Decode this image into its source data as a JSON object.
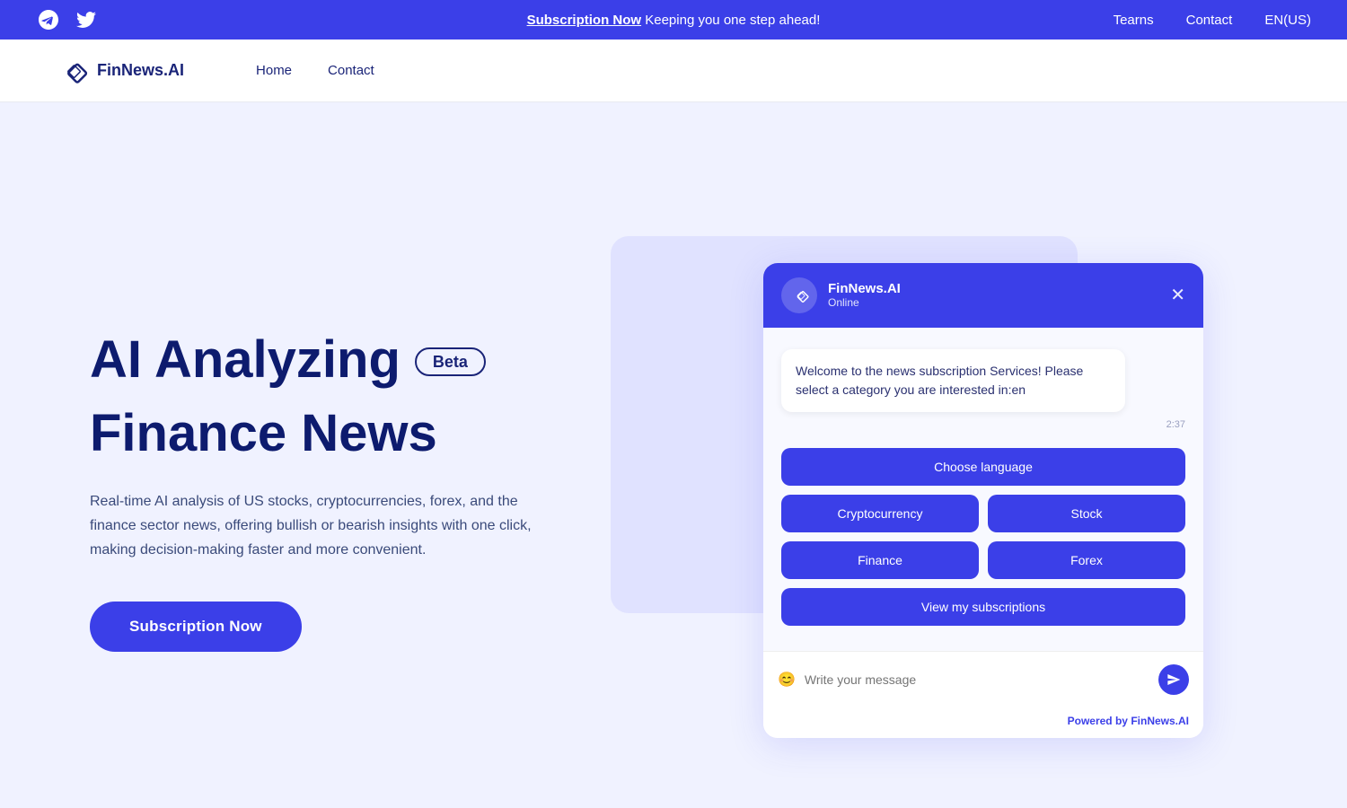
{
  "topBanner": {
    "subscriptionLink": "Subscription Now",
    "tagline": " Keeping you one step ahead!",
    "navItems": [
      "Tearns",
      "Contact",
      "EN(US)"
    ]
  },
  "navbar": {
    "logoText": "FinNews.AI",
    "links": [
      "Home",
      "Contact"
    ]
  },
  "hero": {
    "titleLine1": "AI Analyzing",
    "titleLine2": "Finance News",
    "badge": "Beta",
    "subtitle": "Real-time AI analysis of US stocks, cryptocurrencies, forex, and the finance sector news, offering bullish or bearish insights with one click, making decision-making faster and more convenient.",
    "ctaButton": "Subscription Now"
  },
  "chatWidget": {
    "headerName": "FinNews.AI",
    "headerStatus": "Online",
    "welcomeMessage": "Welcome to the news subscription Services! Please select a category you are interested in:en",
    "timestamp": "2:37",
    "buttons": {
      "chooseLanguage": "Choose language",
      "cryptocurrency": "Cryptocurrency",
      "stock": "Stock",
      "finance": "Finance",
      "forex": "Forex",
      "viewSubscriptions": "View my subscriptions"
    },
    "inputPlaceholder": "Write your message",
    "poweredByLabel": "Powered by",
    "poweredByBrand": " FinNews.AI",
    "closeIcon": "✕"
  }
}
